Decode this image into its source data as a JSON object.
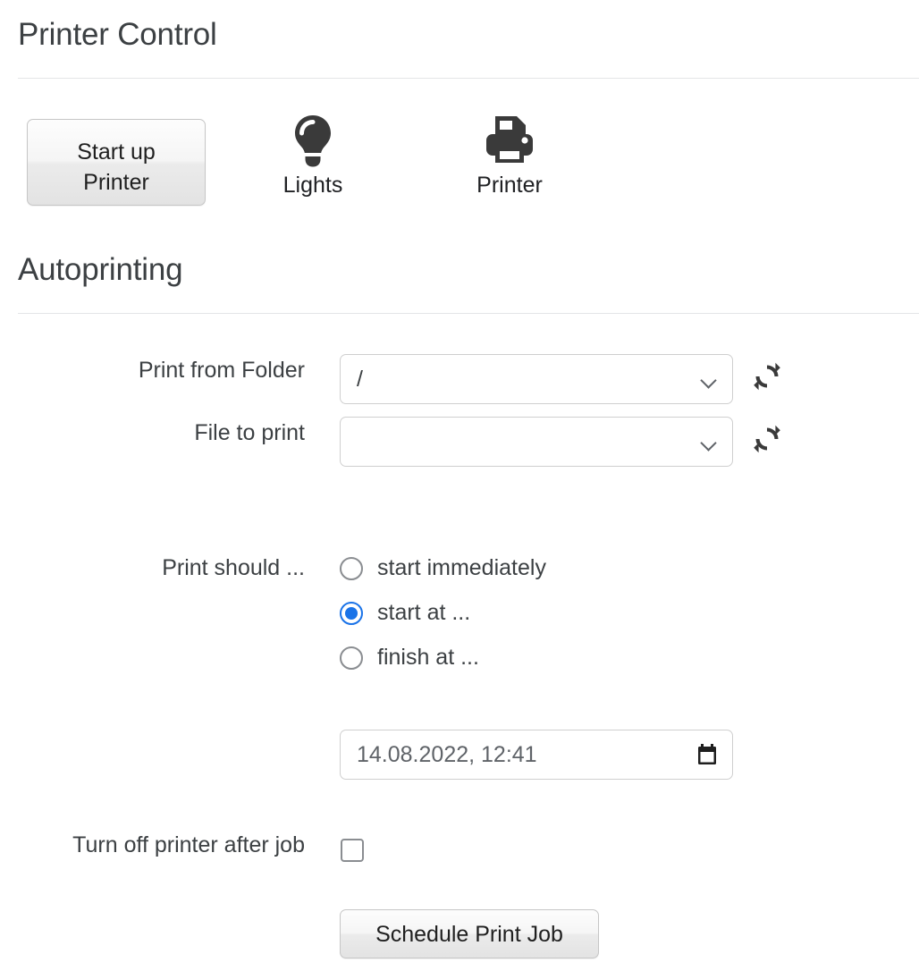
{
  "header": {
    "title": "Printer Control"
  },
  "toolbar": {
    "startup_button_label": "Start up\nPrinter",
    "tiles": [
      {
        "icon": "lightbulb-icon",
        "label": "Lights"
      },
      {
        "icon": "printer-icon",
        "label": "Printer"
      }
    ]
  },
  "autoprinting": {
    "title": "Autoprinting",
    "fields": {
      "print_from_folder": {
        "label": "Print from Folder",
        "value": "/",
        "refresh_icon": "refresh-icon"
      },
      "file_to_print": {
        "label": "File to print",
        "value": "",
        "refresh_icon": "refresh-icon"
      }
    },
    "schedule_mode": {
      "label": "Print should ...",
      "options": [
        {
          "label": "start immediately",
          "selected": false
        },
        {
          "label": "start at ...",
          "selected": true
        },
        {
          "label": "finish at ...",
          "selected": false
        }
      ]
    },
    "datetime": {
      "value": "14.08.2022, 12:41",
      "icon": "calendar-icon"
    },
    "turn_off_after_job": {
      "label": "Turn off printer after job",
      "checked": false
    },
    "submit_button_label": "Schedule Print Job"
  },
  "colors": {
    "accent_blue": "#1a73e8",
    "text": "#3c4043",
    "icon_dark": "#3a3a3a",
    "border": "#cfcfcf",
    "rule": "#e4e5e7"
  }
}
